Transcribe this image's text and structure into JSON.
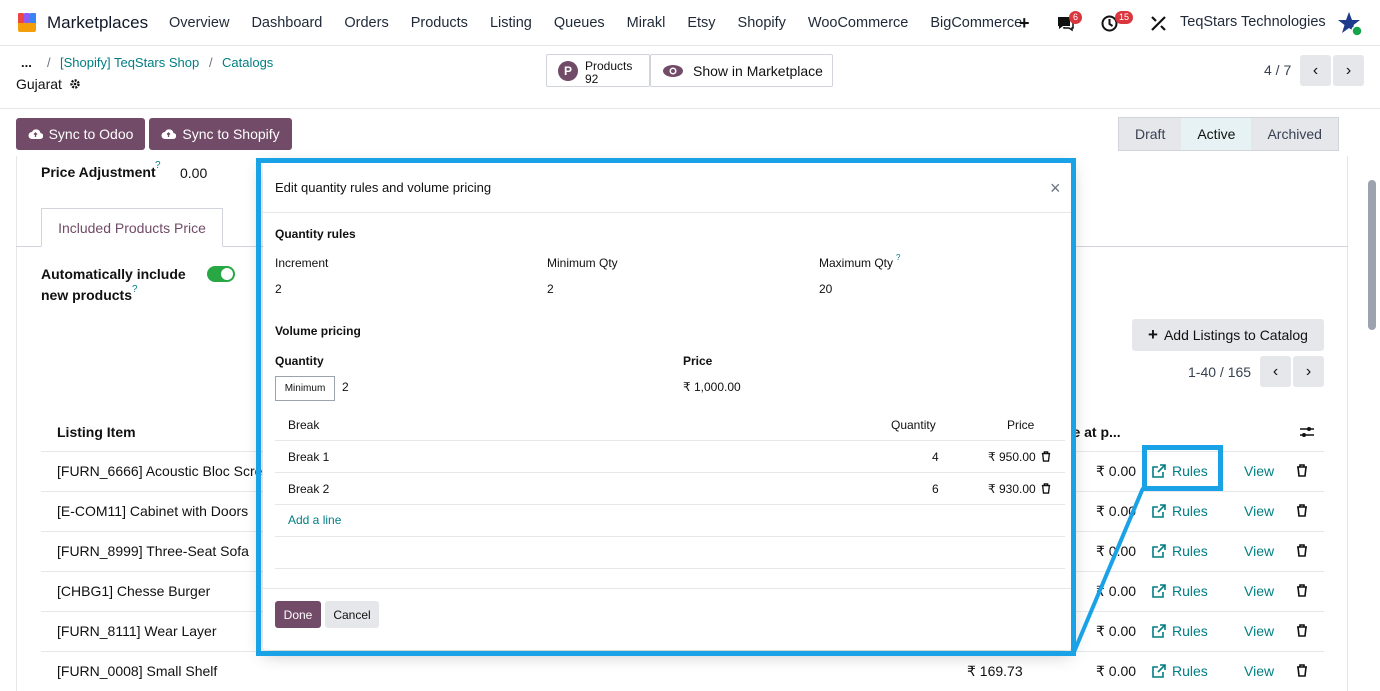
{
  "navbar": {
    "app_name": "Marketplaces",
    "menu": [
      "Overview",
      "Dashboard",
      "Orders",
      "Products",
      "Listing",
      "Queues",
      "Mirakl",
      "Etsy",
      "Shopify",
      "WooCommerce",
      "BigCommerce"
    ],
    "messages_count": "6",
    "activity_count": "15",
    "company": "TeqStars Technologies"
  },
  "breadcrumb": {
    "ellipsis": "...",
    "sep": "/",
    "shop": "[Shopify] TeqStars Shop",
    "catalogs": "Catalogs",
    "current": "Gujarat"
  },
  "stat_buttons": {
    "products_label": "Products",
    "products_count": "92",
    "show_marketplace": "Show in Marketplace"
  },
  "pager": {
    "value": "4 / 7"
  },
  "actions": {
    "sync_odoo": "Sync to Odoo",
    "sync_shopify": "Sync to Shopify"
  },
  "statusbar": {
    "draft": "Draft",
    "active": "Active",
    "archived": "Archived"
  },
  "form": {
    "price_adjustment_label": "Price Adjustment",
    "price_adjustment_value": "0.00",
    "help_mark": "?",
    "tab_label": "Included Products Price",
    "auto_include_line1": "Automatically include",
    "auto_include_line2": "new products",
    "add_listings": "Add Listings to Catalog",
    "list_pager": "1-40 / 165"
  },
  "list": {
    "col_listing": "Listing Item",
    "col_partial": "re at p...",
    "rules_label": "Rules",
    "view_label": "View",
    "rows": [
      {
        "name": "[FURN_6666] Acoustic Bloc Scre",
        "price": "",
        "compare": "₹ 0.00"
      },
      {
        "name": "[E-COM11] Cabinet with Doors",
        "price": "",
        "compare": "₹ 0.00"
      },
      {
        "name": "[FURN_8999] Three-Seat Sofa",
        "price": "",
        "compare": "₹ 0.00"
      },
      {
        "name": "[CHBG1] Chesse Burger",
        "price": "",
        "compare": "₹ 0.00"
      },
      {
        "name": "[FURN_8111] Wear Layer",
        "price": "",
        "compare": "₹ 0.00"
      },
      {
        "name": "[FURN_0008] Small Shelf",
        "price": "₹ 169.73",
        "compare": "₹ 0.00"
      }
    ]
  },
  "modal": {
    "title": "Edit quantity rules and volume pricing",
    "close": "×",
    "quantity_rules": "Quantity rules",
    "increment_label": "Increment",
    "increment_value": "2",
    "min_qty_label": "Minimum Qty",
    "min_qty_value": "2",
    "max_qty_label": "Maximum Qty",
    "max_qty_value": "20",
    "volume_pricing": "Volume pricing",
    "quantity_label": "Quantity",
    "price_label": "Price",
    "minimum_box": "Minimum",
    "minimum_value": "2",
    "base_price": "₹ 1,000.00",
    "table_headers": {
      "break": "Break",
      "quantity": "Quantity",
      "price": "Price"
    },
    "breaks": [
      {
        "name": "Break 1",
        "quantity": "4",
        "price": "₹ 950.00"
      },
      {
        "name": "Break 2",
        "quantity": "6",
        "price": "₹ 930.00"
      }
    ],
    "add_line": "Add a line",
    "done": "Done",
    "cancel": "Cancel"
  },
  "colors": {
    "brand": "#714b67",
    "link": "#017e84",
    "highlight": "#19a3e6"
  }
}
